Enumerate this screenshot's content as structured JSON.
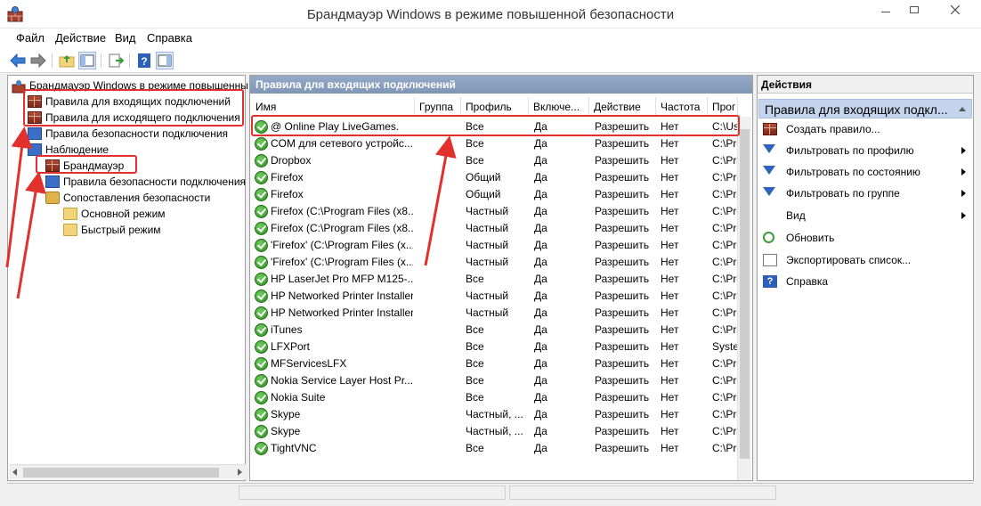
{
  "window": {
    "title": "Брандмауэр Windows в режиме повышенной безопасности"
  },
  "menu": [
    "Файл",
    "Действие",
    "Вид",
    "Справка"
  ],
  "tree": {
    "root": "Брандмауэр Windows в режиме повышенны",
    "inbound": "Правила для входящих подключений",
    "outbound": "Правила для исходящего подключения",
    "conn_security": "Правила безопасности подключения",
    "monitoring": "Наблюдение",
    "firewall": "Брандмауэр",
    "mon_conn_security": "Правила безопасности подключения",
    "security_assoc": "Сопоставления безопасности",
    "main_mode": "Основной режим",
    "quick_mode": "Быстрый режим"
  },
  "center": {
    "header": "Правила для входящих подключений",
    "columns": [
      "Имя",
      "Группа",
      "Профиль",
      "Включе...",
      "Действие",
      "Частота",
      "Прог"
    ],
    "rows": [
      {
        "name": "@ Online Play LiveGames.",
        "group": "",
        "profile": "Все",
        "enabled": "Да",
        "action": "Разрешить",
        "override": "Нет",
        "program": "C:\\Us"
      },
      {
        "name": "COM для сетевого устройс...",
        "group": "",
        "profile": "Все",
        "enabled": "Да",
        "action": "Разрешить",
        "override": "Нет",
        "program": "C:\\Pro"
      },
      {
        "name": "Dropbox",
        "group": "",
        "profile": "Все",
        "enabled": "Да",
        "action": "Разрешить",
        "override": "Нет",
        "program": "C:\\Pro"
      },
      {
        "name": "Firefox",
        "group": "",
        "profile": "Общий",
        "enabled": "Да",
        "action": "Разрешить",
        "override": "Нет",
        "program": "C:\\Pro"
      },
      {
        "name": "Firefox",
        "group": "",
        "profile": "Общий",
        "enabled": "Да",
        "action": "Разрешить",
        "override": "Нет",
        "program": "C:\\Pro"
      },
      {
        "name": "Firefox (C:\\Program Files (x8...",
        "group": "",
        "profile": "Частный",
        "enabled": "Да",
        "action": "Разрешить",
        "override": "Нет",
        "program": "C:\\Pro"
      },
      {
        "name": "Firefox (C:\\Program Files (x8...",
        "group": "",
        "profile": "Частный",
        "enabled": "Да",
        "action": "Разрешить",
        "override": "Нет",
        "program": "C:\\Pro"
      },
      {
        "name": "'Firefox' (C:\\Program Files (x...",
        "group": "",
        "profile": "Частный",
        "enabled": "Да",
        "action": "Разрешить",
        "override": "Нет",
        "program": "C:\\Pro"
      },
      {
        "name": "'Firefox' (C:\\Program Files (x...",
        "group": "",
        "profile": "Частный",
        "enabled": "Да",
        "action": "Разрешить",
        "override": "Нет",
        "program": "C:\\Pro"
      },
      {
        "name": "HP LaserJet Pro MFP M125-...",
        "group": "",
        "profile": "Все",
        "enabled": "Да",
        "action": "Разрешить",
        "override": "Нет",
        "program": "C:\\Pro"
      },
      {
        "name": "HP Networked Printer Installer",
        "group": "",
        "profile": "Частный",
        "enabled": "Да",
        "action": "Разрешить",
        "override": "Нет",
        "program": "C:\\Pro"
      },
      {
        "name": "HP Networked Printer Installer",
        "group": "",
        "profile": "Частный",
        "enabled": "Да",
        "action": "Разрешить",
        "override": "Нет",
        "program": "C:\\Pro"
      },
      {
        "name": "iTunes",
        "group": "",
        "profile": "Все",
        "enabled": "Да",
        "action": "Разрешить",
        "override": "Нет",
        "program": "C:\\Pro"
      },
      {
        "name": "LFXPort",
        "group": "",
        "profile": "Все",
        "enabled": "Да",
        "action": "Разрешить",
        "override": "Нет",
        "program": "Syster"
      },
      {
        "name": "MFServicesLFX",
        "group": "",
        "profile": "Все",
        "enabled": "Да",
        "action": "Разрешить",
        "override": "Нет",
        "program": "C:\\Pro"
      },
      {
        "name": "Nokia Service Layer Host Pr...",
        "group": "",
        "profile": "Все",
        "enabled": "Да",
        "action": "Разрешить",
        "override": "Нет",
        "program": "C:\\Pro"
      },
      {
        "name": "Nokia Suite",
        "group": "",
        "profile": "Все",
        "enabled": "Да",
        "action": "Разрешить",
        "override": "Нет",
        "program": "C:\\Pro"
      },
      {
        "name": "Skype",
        "group": "",
        "profile": "Частный, ...",
        "enabled": "Да",
        "action": "Разрешить",
        "override": "Нет",
        "program": "C:\\Pro"
      },
      {
        "name": "Skype",
        "group": "",
        "profile": "Частный, ...",
        "enabled": "Да",
        "action": "Разрешить",
        "override": "Нет",
        "program": "C:\\Pro"
      },
      {
        "name": "TightVNC",
        "group": "",
        "profile": "Все",
        "enabled": "Да",
        "action": "Разрешить",
        "override": "Нет",
        "program": "C:\\Pro"
      }
    ]
  },
  "actions": {
    "header": "Действия",
    "section": "Правила для входящих подкл...",
    "items": [
      {
        "label": "Создать правило...",
        "icon": "new-rule-icon",
        "submenu": false
      },
      {
        "label": "Фильтровать по профилю",
        "icon": "filter-icon",
        "submenu": true
      },
      {
        "label": "Фильтровать по состоянию",
        "icon": "filter-icon",
        "submenu": true
      },
      {
        "label": "Фильтровать по группе",
        "icon": "filter-icon",
        "submenu": true
      },
      {
        "label": "Вид",
        "icon": "",
        "submenu": true
      },
      {
        "label": "Обновить",
        "icon": "refresh-icon",
        "submenu": false
      },
      {
        "label": "Экспортировать список...",
        "icon": "export-icon",
        "submenu": false
      },
      {
        "label": "Справка",
        "icon": "help-icon",
        "submenu": false
      }
    ]
  },
  "colors": {
    "annotation": "#e2312d",
    "header_blue": "#7f96b6",
    "section_blue": "#c4d4ec"
  }
}
